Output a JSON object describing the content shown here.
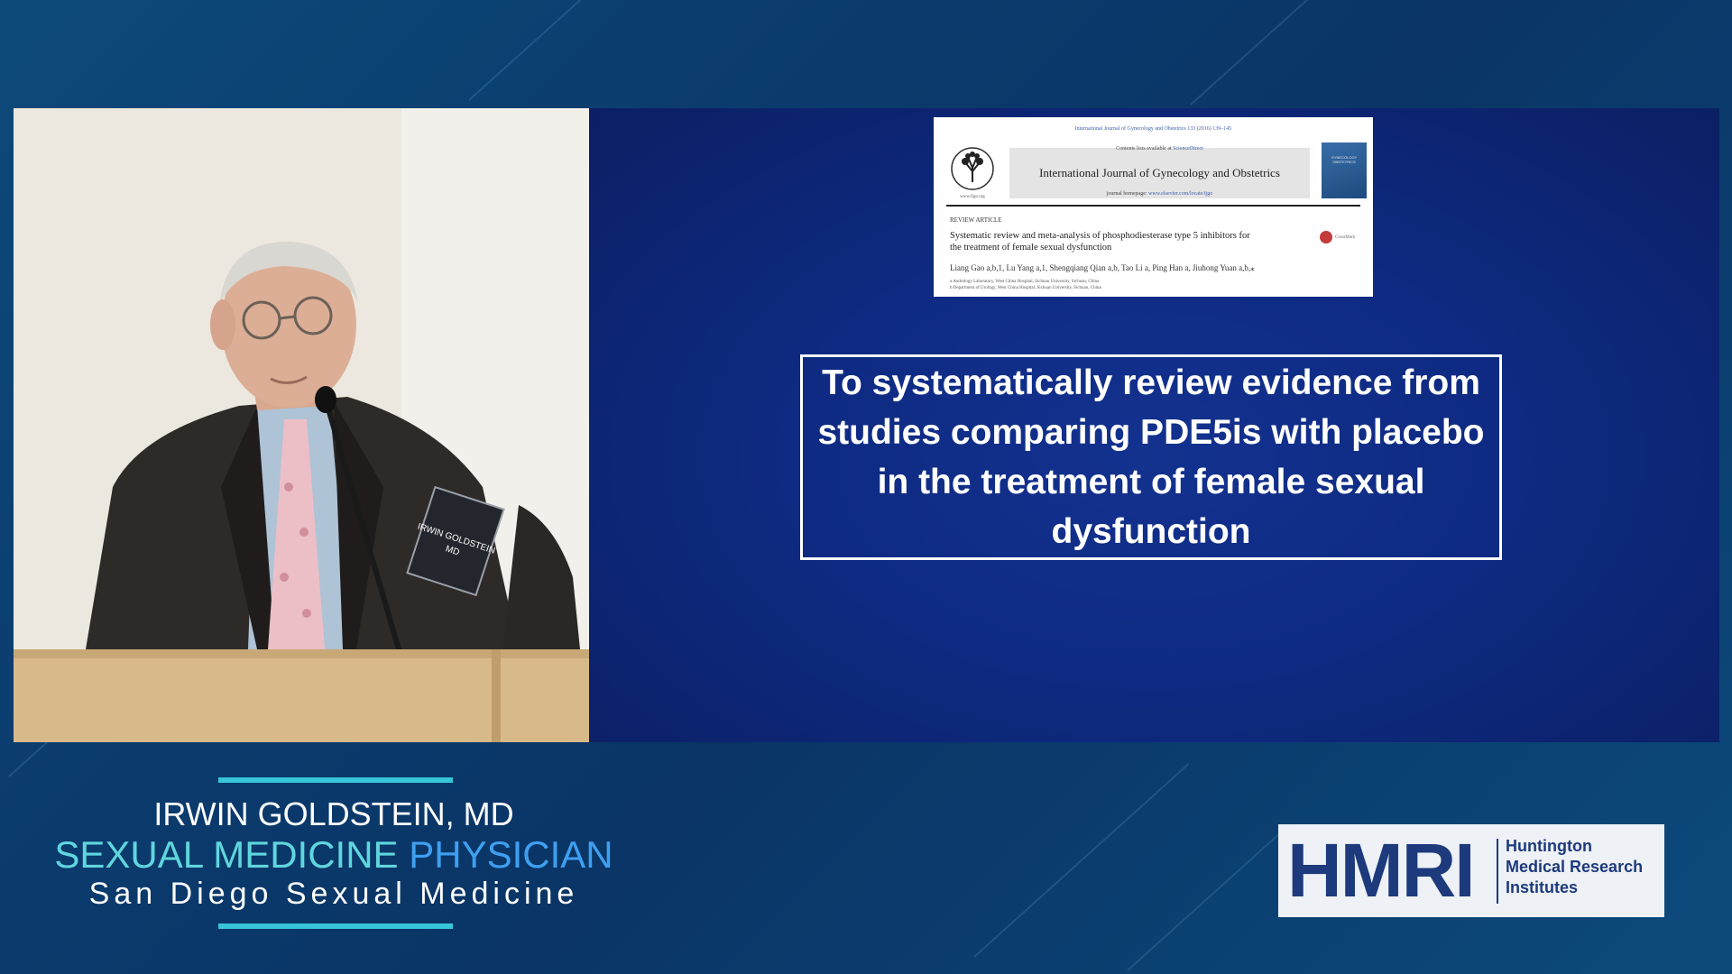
{
  "slide": {
    "objective": "To systematically review evidence from studies comparing PDE5is with placebo in the treatment of female sexual dysfunction"
  },
  "paper": {
    "citation": "International Journal of Gynecology and Obstetrics 133 (2016) 139–145",
    "contents_prefix": "Contents lists available at",
    "contents_link": "ScienceDirect",
    "journal_name": "International Journal of Gynecology and Obstetrics",
    "homepage_prefix": "journal homepage:",
    "homepage_url": "www.elsevier.com/locate/ijgo",
    "figo_url": "www.figo.org",
    "section": "REVIEW ARTICLE",
    "title": "Systematic review and meta-analysis of phosphodiesterase type 5 inhibitors for the treatment of female sexual dysfunction",
    "authors": "Liang Gao a,b,1, Lu Yang a,1, Shengqiang Qian a,b, Tao Li a, Ping Han a, Jiuhong Yuan a,b,⁎",
    "affiliation_a": "a Andrology Laboratory, West China Hospital, Sichuan University, Sichuan, China",
    "affiliation_b": "b Department of Urology, West China Hospital, Sichuan University, Sichuan, China",
    "crossmark": "CrossMark",
    "cover_text": "GYNECOLOGY OBSTETRICS"
  },
  "speaker": {
    "name": "IRWIN GOLDSTEIN, MD",
    "title_part1": "SEXUAL MEDICINE",
    "title_part2": "PHYSICIAN",
    "organization": "San Diego Sexual Medicine",
    "badge_line1": "IRWIN GOLDSTEIN",
    "badge_line2": "MD"
  },
  "logo": {
    "mark": "HMRI",
    "line1": "Huntington",
    "line2": "Medical Research",
    "line3": "Institutes"
  },
  "colors": {
    "accent_cyan": "#37c6d9",
    "slide_blue": "#0e2a82",
    "logo_navy": "#1d3a7c"
  }
}
